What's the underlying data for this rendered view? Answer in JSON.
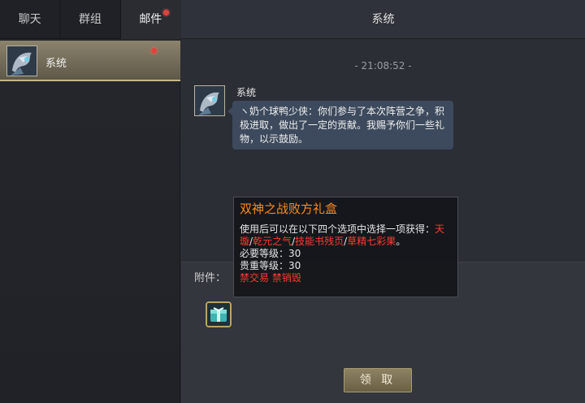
{
  "tabs": [
    {
      "label": "聊天"
    },
    {
      "label": "群组"
    },
    {
      "label": "邮件"
    }
  ],
  "contact": {
    "name": "系统"
  },
  "header": {
    "title": "系统"
  },
  "message": {
    "timestamp": "- 21:08:52 -",
    "sender": "系统",
    "text": "ヽ奶个球鸭少侠：你们参与了本次阵营之争，积极进取，做出了一定的贡献。我赐予你们一些礼物，以示鼓励。"
  },
  "attachment": {
    "label": "附件：",
    "claim_label": "领 取"
  },
  "tooltip": {
    "title": "双神之战败方礼盒",
    "desc_prefix": "使用后可以在以下四个选项中选择一项获得：",
    "options": [
      "天璇",
      "乾元之气",
      "技能书残页",
      "草精七彩果"
    ],
    "separator": "/",
    "period": "。",
    "required_level": "必要等级：30",
    "rarity_level": "贵重等级：30",
    "restrictions": "禁交易 禁销毁"
  },
  "colors": {
    "accent_orange": "#ff8a1e",
    "restriction_red": "#ff3b2f",
    "notify_dot": "#e0433a"
  }
}
